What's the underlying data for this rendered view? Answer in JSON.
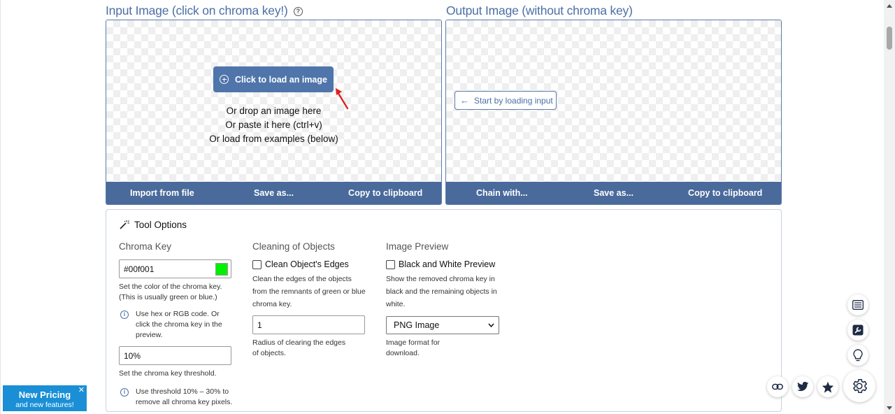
{
  "input_panel": {
    "title": "Input Image (click on chroma key!)",
    "load_button": "Click to load an image",
    "drop_lines": [
      "Or drop an image here",
      "Or paste it here (ctrl+v)",
      "Or load from examples (below)"
    ],
    "bar": [
      "Import from file",
      "Save as...",
      "Copy to clipboard"
    ]
  },
  "output_panel": {
    "title": "Output Image (without chroma key)",
    "start_button": "Start by loading input",
    "bar": [
      "Chain with...",
      "Save as...",
      "Copy to clipboard"
    ]
  },
  "tool_options": {
    "title": "Tool Options",
    "chroma_key": {
      "heading": "Chroma Key",
      "color_value": "#00f001",
      "color_hint_1": "Set the color of the chroma key.",
      "color_hint_2": "(This is usually green or blue.)",
      "info_1": "Use hex or RGB code. Or click the chroma key in the preview.",
      "threshold_value": "10%",
      "threshold_hint": "Set the chroma key threshold.",
      "info_2": "Use threshold 10% – 30% to remove all chroma key pixels."
    },
    "cleaning": {
      "heading": "Cleaning of Objects",
      "checkbox_label": "Clean Object's Edges",
      "checkbox_hint": "Clean the edges of the objects from the remnants of green or blue chroma key.",
      "radius_value": "1",
      "radius_hint": "Radius of clearing the edges of objects."
    },
    "preview": {
      "heading": "Image Preview",
      "checkbox_label": "Black and White Preview",
      "checkbox_hint": "Show the removed chroma key in black and the remaining objects in white.",
      "format_value": "PNG Image",
      "format_hint": "Image format for download."
    }
  },
  "pricing_banner": {
    "line1": "New Pricing",
    "line2": "and new features!",
    "close": "✕"
  },
  "icons": {
    "list": "list-icon",
    "wrench": "wrench-icon",
    "bulb": "lightbulb-icon",
    "link": "link-icon",
    "twitter": "twitter-icon",
    "star": "star-icon",
    "settings": "gear-icon"
  },
  "colors": {
    "accent": "#496a9b",
    "chroma": "#00f001",
    "pricing": "#1a8fd6"
  }
}
